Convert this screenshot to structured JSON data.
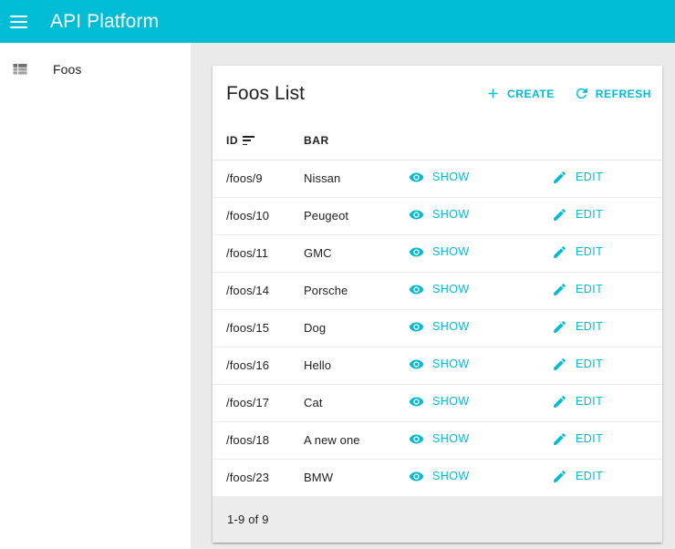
{
  "appbar": {
    "menu_icon": "hamburger-menu-icon",
    "title": "API Platform"
  },
  "sidebar": {
    "items": [
      {
        "icon": "view-list-icon",
        "label": "Foos"
      }
    ]
  },
  "card": {
    "title": "Foos List",
    "actions": [
      {
        "id": "create",
        "icon": "plus-icon",
        "label": "CREATE"
      },
      {
        "id": "refresh",
        "icon": "refresh-icon",
        "label": "REFRESH"
      }
    ],
    "table": {
      "columns": [
        {
          "key": "id",
          "label": "ID",
          "sortable": true,
          "sort_icon": "sort-descending-icon"
        },
        {
          "key": "bar",
          "label": "BAR",
          "sortable": false
        },
        {
          "key": "show",
          "label": "",
          "sortable": false
        },
        {
          "key": "edit",
          "label": "",
          "sortable": false
        }
      ],
      "row_actions": [
        {
          "id": "show",
          "icon": "eye-icon",
          "label": "SHOW"
        },
        {
          "id": "edit",
          "icon": "pencil-icon",
          "label": "EDIT"
        }
      ],
      "rows": [
        {
          "id": "/foos/9",
          "bar": "Nissan"
        },
        {
          "id": "/foos/10",
          "bar": "Peugeot"
        },
        {
          "id": "/foos/11",
          "bar": "GMC"
        },
        {
          "id": "/foos/14",
          "bar": "Porsche"
        },
        {
          "id": "/foos/15",
          "bar": "Dog"
        },
        {
          "id": "/foos/16",
          "bar": "Hello"
        },
        {
          "id": "/foos/17",
          "bar": "Cat"
        },
        {
          "id": "/foos/18",
          "bar": "A new one"
        },
        {
          "id": "/foos/23",
          "bar": "BMW"
        }
      ]
    },
    "pagination": {
      "range_label": "1-9 of 9"
    }
  },
  "colors": {
    "accent": "#00bcd4",
    "appbar_bg": "#00bcd4",
    "page_bg": "#eaeaea",
    "card_bg": "#ffffff",
    "footer_bg": "#ececec",
    "text": "#212121"
  }
}
